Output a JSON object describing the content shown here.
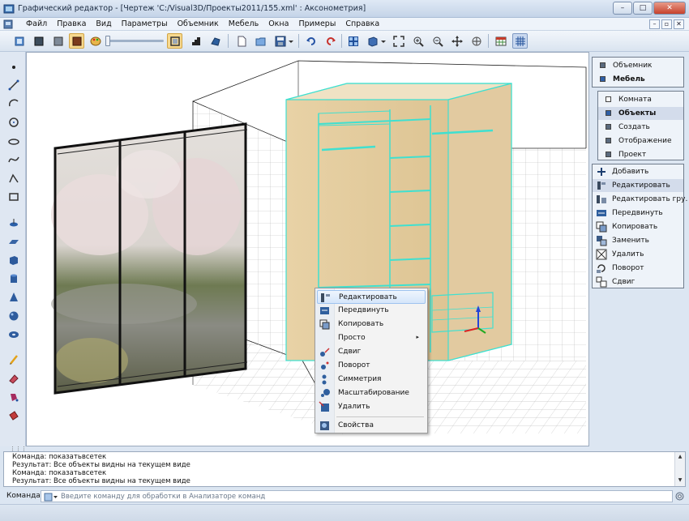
{
  "window": {
    "title": "Графический редактор - [Чертеж 'C:/Visual3D/Проекты2011/155.xml' : Аксонометрия]",
    "minimize": "–",
    "maximize": "□",
    "close": "✕"
  },
  "menu": {
    "items": [
      "Файл",
      "Правка",
      "Вид",
      "Параметры",
      "Объемник",
      "Мебель",
      "Окна",
      "Примеры",
      "Справка"
    ],
    "mdi": [
      "–",
      "▫",
      "✕"
    ]
  },
  "toolbar": {
    "icons": [
      "select-icon",
      "dark-cube-icon",
      "wood-cube-icon",
      "palette-icon",
      "wireframe-cube-icon",
      "stairs-icon",
      "solid-shape-icon",
      "new-document-icon",
      "open-folder-icon",
      "save-icon",
      "dropdown-icon",
      "undo-icon",
      "redo-icon",
      "layout-icon",
      "view-cube-icon",
      "zoom-fit-icon",
      "zoom-in-icon",
      "zoom-out-icon",
      "pan-icon",
      "rotate-icon",
      "table-icon",
      "grid-icon"
    ]
  },
  "lefttools": {
    "icons": [
      "point-icon",
      "line-icon",
      "arc-icon",
      "circle-icon",
      "ellipse-icon",
      "spline-icon",
      "polyline-icon",
      "rectangle-icon",
      "solid-icon",
      "plane-icon",
      "box-icon",
      "cylinder-icon",
      "cone-icon",
      "sphere-icon",
      "torus-icon",
      "pencil-icon",
      "eraser-icon",
      "paint-icon",
      "brush-icon"
    ]
  },
  "context_menu": {
    "items": [
      {
        "label": "Редактировать",
        "highlight": true
      },
      {
        "label": "Передвинуть"
      },
      {
        "label": "Копировать"
      },
      {
        "label": "Просто",
        "submenu": "▸"
      },
      {
        "label": "Сдвиг"
      },
      {
        "label": "Поворот"
      },
      {
        "label": "Симметрия"
      },
      {
        "label": "Масштабирование"
      },
      {
        "label": "Удалить"
      },
      {
        "label": "Свойства"
      }
    ]
  },
  "right_panel": {
    "tabs": [
      {
        "label": "Объемник",
        "bold": false
      },
      {
        "label": "Мебель",
        "bold": true
      }
    ],
    "sections": [
      {
        "label": "Комната",
        "bold": false
      },
      {
        "label": "Объекты",
        "bold": true
      },
      {
        "label": "Создать",
        "bold": false
      },
      {
        "label": "Отображение",
        "bold": false
      },
      {
        "label": "Проект",
        "bold": false
      }
    ],
    "actions": [
      {
        "label": "Добавить"
      },
      {
        "label": "Редактировать"
      },
      {
        "label": "Редактировать гру..."
      },
      {
        "label": "Передвинуть"
      },
      {
        "label": "Копировать"
      },
      {
        "label": "Заменить"
      },
      {
        "label": "Удалить"
      },
      {
        "label": "Поворот"
      },
      {
        "label": "Сдвиг"
      }
    ]
  },
  "log": {
    "lines": [
      "Команда: показатьвсетек",
      "Результат: Все объекты видны на текущем виде",
      "Команда: показатьвсетек",
      "Результат: Все объекты видны на текущем виде"
    ]
  },
  "command": {
    "label": "Команда:",
    "placeholder": "Введите команду для обработки в Анализаторе команд"
  },
  "colors": {
    "accent_cyan": "#3fe0d0",
    "wood": "#e6d2a8",
    "highlight": "#d5e6fa"
  }
}
